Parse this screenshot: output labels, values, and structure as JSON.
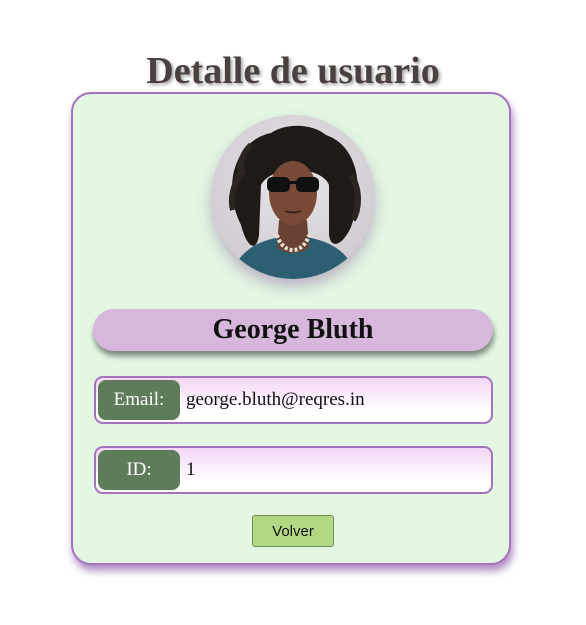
{
  "page": {
    "title": "Detalle de usuario"
  },
  "user": {
    "name": "George Bluth",
    "avatar_icon": "user-avatar-photo"
  },
  "fields": {
    "email": {
      "label": "Email:",
      "value": "george.bluth@reqres.in"
    },
    "id": {
      "label": "ID:",
      "value": "1"
    }
  },
  "actions": {
    "back_label": "Volver"
  },
  "colors": {
    "card_background": "#e3f7e3",
    "card_border": "#a572bd",
    "name_bar": "#d7b8dc",
    "label_background": "#5e7c5a",
    "button_background": "#b3d884",
    "title_text": "#4a403f"
  }
}
